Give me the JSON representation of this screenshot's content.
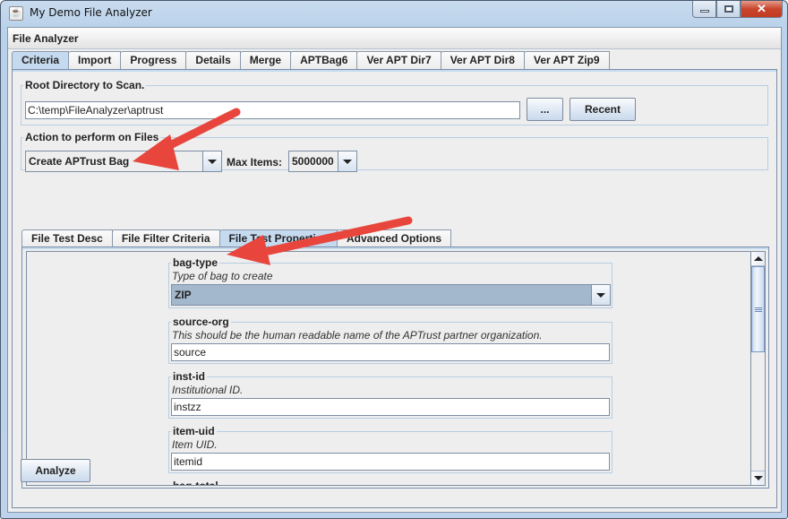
{
  "window": {
    "title": "My Demo File Analyzer",
    "controls": {
      "minimize": "minimize",
      "maximize": "maximize",
      "close": "✕"
    }
  },
  "frame": {
    "header": "File Analyzer"
  },
  "main_tabs": [
    {
      "label": "Criteria",
      "active": true
    },
    {
      "label": "Import"
    },
    {
      "label": "Progress"
    },
    {
      "label": "Details"
    },
    {
      "label": "Merge"
    },
    {
      "label": "APTBag6"
    },
    {
      "label": "Ver APT Dir7"
    },
    {
      "label": "Ver APT Dir8"
    },
    {
      "label": "Ver APT Zip9"
    }
  ],
  "root_dir": {
    "legend": "Root Directory to Scan.",
    "value": "C:\\temp\\FileAnalyzer\\aptrust",
    "browse_label": "...",
    "recent_label": "Recent"
  },
  "action": {
    "legend": "Action to perform on Files",
    "selected": "Create APTrust Bag",
    "max_items_label": "Max Items:",
    "max_items_value": "5000000"
  },
  "sub_tabs": [
    {
      "label": "File Test Desc"
    },
    {
      "label": "File Filter Criteria"
    },
    {
      "label": "File Test Properties",
      "active": true
    },
    {
      "label": "Advanced Options"
    }
  ],
  "properties": [
    {
      "name": "bag-type",
      "desc": "Type of bag to create",
      "type": "combo",
      "value": "ZIP"
    },
    {
      "name": "source-org",
      "desc": "This should be the human readable name of the APTrust partner organization.",
      "type": "text",
      "value": "source"
    },
    {
      "name": "inst-id",
      "desc": "Institutional ID.",
      "type": "text",
      "value": "instzz"
    },
    {
      "name": "item-uid",
      "desc": "Item UID.",
      "type": "text",
      "value": "itemid"
    },
    {
      "name": "bag-total",
      "desc": "",
      "type": "partial",
      "value": ""
    }
  ],
  "scrollbar": {
    "position_fraction": 0.0,
    "visible_fraction": 0.37
  },
  "analyze_label": "Analyze",
  "annotation_color": "#e8463d"
}
